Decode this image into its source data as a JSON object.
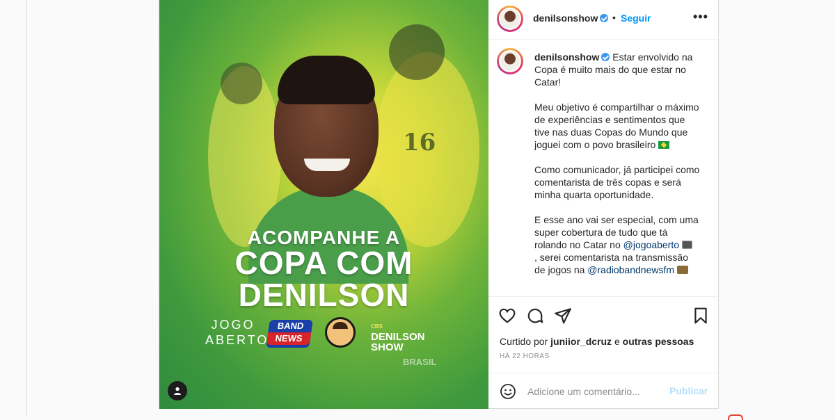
{
  "post": {
    "username": "denilsonshow",
    "follow_label": "Seguir",
    "separator": "•",
    "more_label": "•••"
  },
  "media": {
    "headline_sub": "ACOMPANHE A",
    "headline_line1": "COPA COM",
    "headline_line2": "DENILSON",
    "logo_jogo": "JOGO ABERTO",
    "logo_band_top": "BAND",
    "logo_band_bottom": "NEWS",
    "logo_show": "DENILSON SHOW",
    "logo_show_small": "CBS",
    "jersey_number": "16",
    "brasil_text": "BRASIL"
  },
  "caption": {
    "username": "denilsonshow",
    "p1": " Estar envolvido na Copa é muito mais do que estar no Catar!",
    "p2": "Meu objetivo é compartilhar o máximo de experiências e sentimentos que tive nas duas Copas do Mundo que joguei com o povo brasileiro ",
    "p3": "Como comunicador, já participei como comentarista de três copas e será minha quarta oportunidade.",
    "p4a": "E esse ano vai ser especial, com uma super cobertura de tudo que tá rolando no Catar no ",
    "mention1": "@jogoaberto",
    "p4b": ", serei comentarista na transmissão de jogos na ",
    "mention2": "@radiobandnewsfm"
  },
  "actions": {
    "liked_by_prefix": "Curtido por ",
    "liked_by_user": "juniior_dcruz",
    "liked_by_mid": " e ",
    "liked_by_others": "outras pessoas",
    "time_ago": "HÁ 22 HORAS"
  },
  "comment": {
    "placeholder": "Adicione um comentário...",
    "publish_label": "Publicar"
  },
  "colors": {
    "accent": "#0095f6",
    "publish_disabled": "#b2dffc",
    "verified": "#3897f0"
  }
}
